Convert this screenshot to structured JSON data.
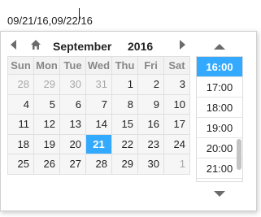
{
  "input": {
    "value": "09/21/16,09/22/16"
  },
  "header": {
    "month": "September",
    "year": "2016"
  },
  "weekdays": [
    "Sun",
    "Mon",
    "Tue",
    "Wed",
    "Thu",
    "Fri",
    "Sat"
  ],
  "weeks": [
    [
      {
        "d": "28",
        "other": true
      },
      {
        "d": "29",
        "other": true
      },
      {
        "d": "30",
        "other": true
      },
      {
        "d": "31",
        "other": true
      },
      {
        "d": "1"
      },
      {
        "d": "2"
      },
      {
        "d": "3"
      }
    ],
    [
      {
        "d": "4"
      },
      {
        "d": "5"
      },
      {
        "d": "6"
      },
      {
        "d": "7"
      },
      {
        "d": "8"
      },
      {
        "d": "9"
      },
      {
        "d": "10"
      }
    ],
    [
      {
        "d": "11"
      },
      {
        "d": "12"
      },
      {
        "d": "13"
      },
      {
        "d": "14"
      },
      {
        "d": "15"
      },
      {
        "d": "16"
      },
      {
        "d": "17"
      }
    ],
    [
      {
        "d": "18"
      },
      {
        "d": "19"
      },
      {
        "d": "20"
      },
      {
        "d": "21",
        "selected": true
      },
      {
        "d": "22"
      },
      {
        "d": "23"
      },
      {
        "d": "24"
      }
    ],
    [
      {
        "d": "25"
      },
      {
        "d": "26"
      },
      {
        "d": "27"
      },
      {
        "d": "28"
      },
      {
        "d": "29"
      },
      {
        "d": "30"
      },
      {
        "d": "1",
        "other": true
      }
    ]
  ],
  "times": [
    {
      "t": "16:00",
      "selected": true
    },
    {
      "t": "17:00"
    },
    {
      "t": "18:00"
    },
    {
      "t": "19:00"
    },
    {
      "t": "20:00"
    },
    {
      "t": "21:00"
    }
  ],
  "colors": {
    "accent": "#33aaff",
    "icon": "#6b6b6b"
  },
  "icons": {
    "prev": "triangle-left-icon",
    "next": "triangle-right-icon",
    "home": "home-icon",
    "up": "triangle-up-icon",
    "down": "triangle-down-icon"
  }
}
